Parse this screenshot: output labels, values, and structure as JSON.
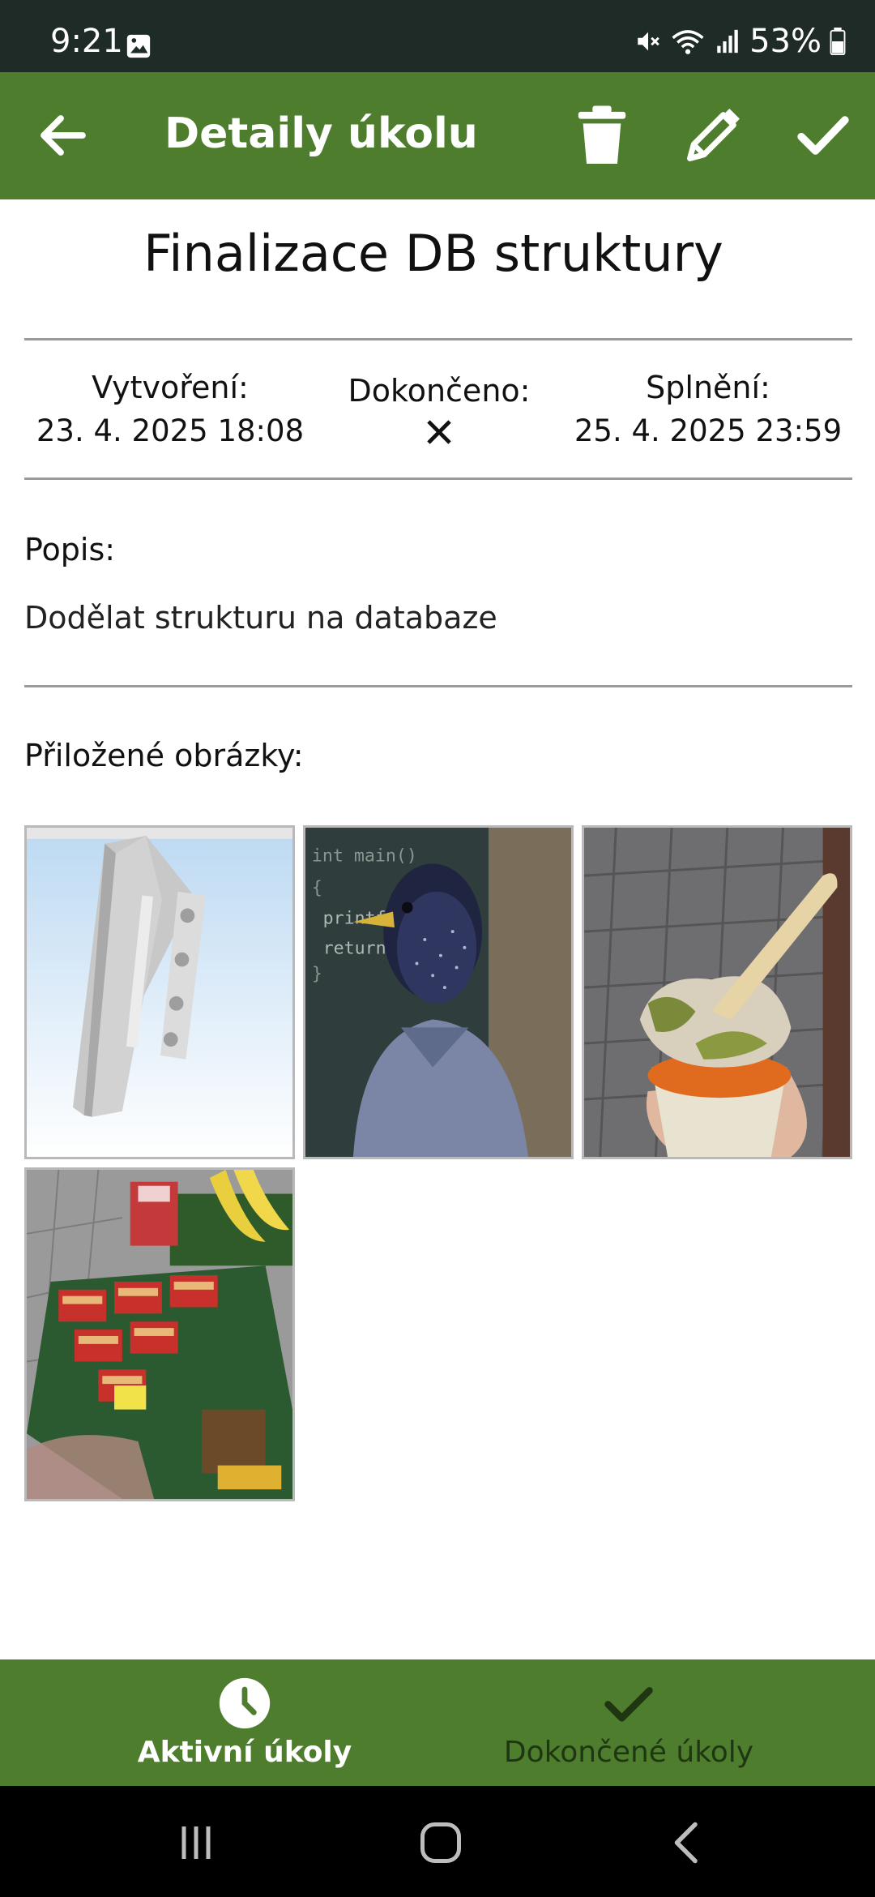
{
  "status_bar": {
    "time": "9:21",
    "battery": "53%"
  },
  "app_bar": {
    "title": "Detaily úkolu",
    "icons": [
      "arrow-left-icon",
      "trash-icon",
      "pencil-icon",
      "check-icon"
    ]
  },
  "task": {
    "title": "Finalizace DB struktury",
    "created_label": "Vytvoření:",
    "created_value": "23. 4. 2025 18:08",
    "completed_label": "Dokončeno:",
    "completed_value": "✕",
    "due_label": "Splnění:",
    "due_value": "25. 4. 2025 23:59",
    "description_label": "Popis:",
    "description": "Dodělat strukturu na databaze",
    "images_label": "Přiložené obrázky:",
    "images": [
      {
        "subject": "3D model of grey bracket"
      },
      {
        "subject": "starling in shirt with code on chalkboard"
      },
      {
        "subject": "ice cream cup with wooden spoon"
      },
      {
        "subject": "supermarket shelf with bananas and wafers"
      }
    ]
  },
  "bottom_nav": {
    "active_label": "Aktivní úkoly",
    "inactive_label": "Dokončené úkoly"
  },
  "colors": {
    "primary": "#4e7d2d",
    "status_bar": "#1e2b26",
    "divider": "#9a9a9a"
  }
}
